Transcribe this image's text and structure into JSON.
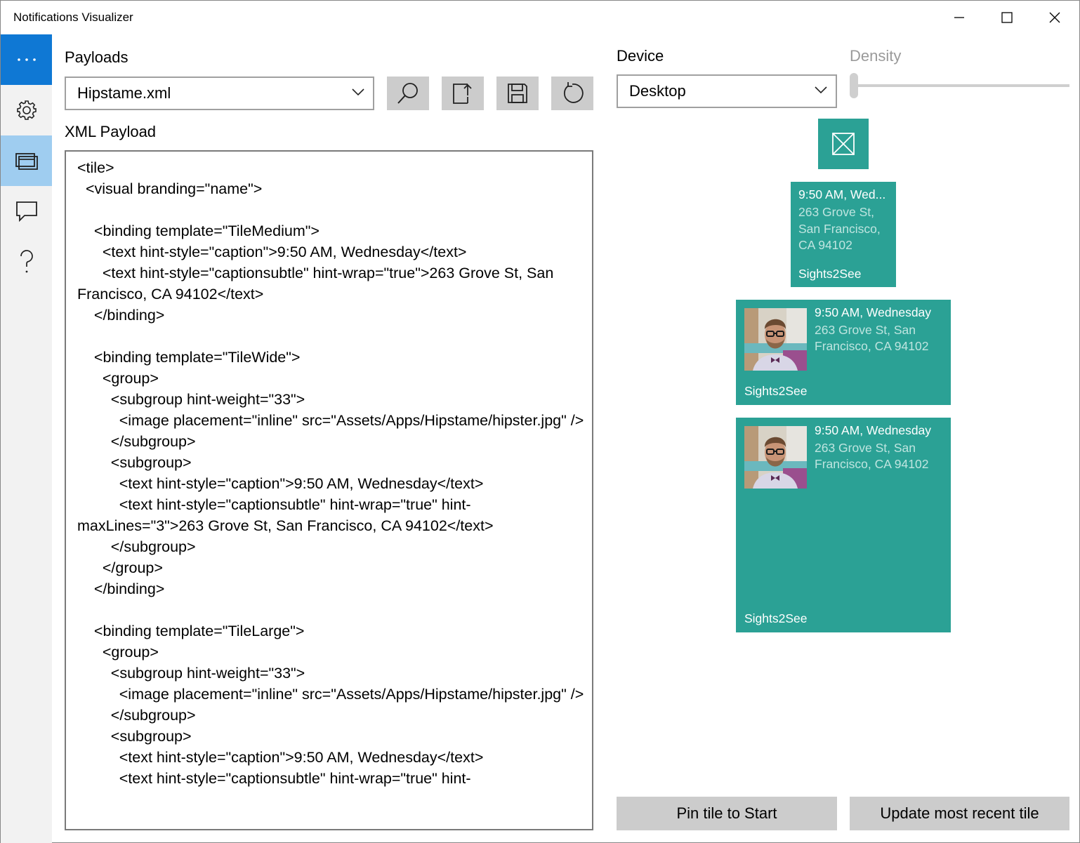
{
  "window": {
    "title": "Notifications Visualizer"
  },
  "nav": {
    "menu_icon": "ellipsis-icon",
    "items": [
      {
        "name": "settings",
        "icon": "gear-icon"
      },
      {
        "name": "tiles",
        "icon": "tiles-icon",
        "selected": true
      },
      {
        "name": "toasts",
        "icon": "speech-bubble-icon"
      },
      {
        "name": "help",
        "icon": "question-mark-icon"
      }
    ]
  },
  "payloads": {
    "label": "Payloads",
    "selected": "Hipstame.xml",
    "tools": [
      "search-icon",
      "open-file-icon",
      "save-icon",
      "refresh-icon"
    ]
  },
  "xml": {
    "label": "XML Payload",
    "content": "<tile>\n  <visual branding=\"name\">\n\n    <binding template=\"TileMedium\">\n      <text hint-style=\"caption\">9:50 AM, Wednesday</text>\n      <text hint-style=\"captionsubtle\" hint-wrap=\"true\">263 Grove St, San Francisco, CA 94102</text>\n    </binding>\n\n    <binding template=\"TileWide\">\n      <group>\n        <subgroup hint-weight=\"33\">\n          <image placement=\"inline\" src=\"Assets/Apps/Hipstame/hipster.jpg\" />\n        </subgroup>\n        <subgroup>\n          <text hint-style=\"caption\">9:50 AM, Wednesday</text>\n          <text hint-style=\"captionsubtle\" hint-wrap=\"true\" hint-maxLines=\"3\">263 Grove St, San Francisco, CA 94102</text>\n        </subgroup>\n      </group>\n    </binding>\n\n    <binding template=\"TileLarge\">\n      <group>\n        <subgroup hint-weight=\"33\">\n          <image placement=\"inline\" src=\"Assets/Apps/Hipstame/hipster.jpg\" />\n        </subgroup>\n        <subgroup>\n          <text hint-style=\"caption\">9:50 AM, Wednesday</text>\n          <text hint-style=\"captionsubtle\" hint-wrap=\"true\" hint-"
  },
  "device": {
    "label": "Device",
    "selected": "Desktop"
  },
  "density": {
    "label": "Density",
    "value_fraction": 0
  },
  "tiles": {
    "accent": "#2ba195",
    "small": {
      "icon": "placeholder-image-icon"
    },
    "medium": {
      "caption": "9:50 AM, Wed...",
      "sub1": "263 Grove St,",
      "sub2": "San Francisco,",
      "sub3": "CA 94102",
      "brand": "Sights2See"
    },
    "wide": {
      "caption": "9:50 AM, Wednesday",
      "sub1": "263 Grove St, San",
      "sub2": "Francisco, CA 94102",
      "brand": "Sights2See"
    },
    "large": {
      "caption": "9:50 AM, Wednesday",
      "sub1": "263 Grove St, San",
      "sub2": "Francisco, CA 94102",
      "brand": "Sights2See"
    }
  },
  "actions": {
    "pin": "Pin tile to Start",
    "update": "Update most recent tile"
  }
}
